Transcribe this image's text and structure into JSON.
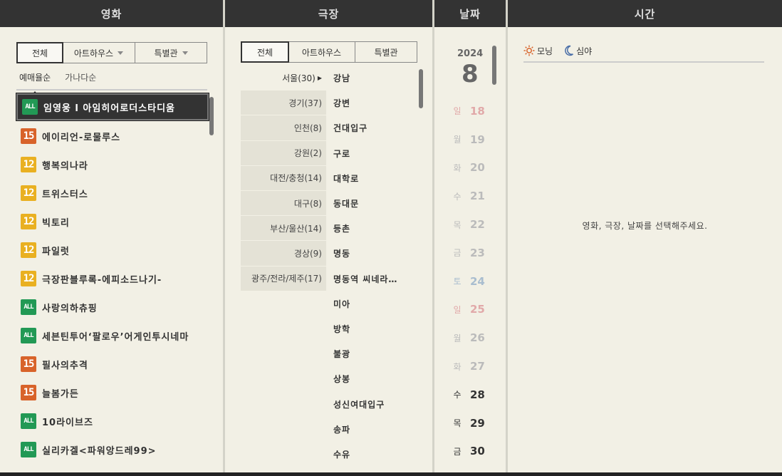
{
  "columns": {
    "movie": "영화",
    "theater": "극장",
    "date": "날짜",
    "time": "시간"
  },
  "movie_tabs": [
    {
      "label": "전체",
      "active": true,
      "dropdown": false
    },
    {
      "label": "아트하우스",
      "active": false,
      "dropdown": true
    },
    {
      "label": "특별관",
      "active": false,
      "dropdown": true
    }
  ],
  "sort": {
    "booking": "예매율순",
    "alpha": "가나다순"
  },
  "movies": [
    {
      "rating": "ALL",
      "title": "임영웅 l 아임히어로더스타디움",
      "selected": true
    },
    {
      "rating": "15",
      "title": "에이리언-로물루스"
    },
    {
      "rating": "12",
      "title": "행복의나라"
    },
    {
      "rating": "12",
      "title": "트위스터스"
    },
    {
      "rating": "12",
      "title": "빅토리"
    },
    {
      "rating": "12",
      "title": "파일럿"
    },
    {
      "rating": "12",
      "title": "극장판블루록-에피소드나기-"
    },
    {
      "rating": "ALL",
      "title": "사랑의하츄핑"
    },
    {
      "rating": "ALL",
      "title": "세븐틴투어‘팔로우’어게인투시네마"
    },
    {
      "rating": "15",
      "title": "필사의추격"
    },
    {
      "rating": "15",
      "title": "늘봄가든"
    },
    {
      "rating": "ALL",
      "title": "10라이브즈"
    },
    {
      "rating": "ALL",
      "title": "실리카겔<파워앙드레99>"
    }
  ],
  "theater_tabs": [
    {
      "label": "전체",
      "active": true
    },
    {
      "label": "아트하우스",
      "active": false
    },
    {
      "label": "특별관",
      "active": false
    }
  ],
  "regions": [
    "서울(30)",
    "경기(37)",
    "인천(8)",
    "강원(2)",
    "대전/충청(14)",
    "대구(8)",
    "부산/울산(14)",
    "경상(9)",
    "광주/전라/제주(17)"
  ],
  "theaters": [
    "강남",
    "강변",
    "건대입구",
    "구로",
    "대학로",
    "동대문",
    "등촌",
    "명동",
    "명동역 씨네라…",
    "미아",
    "방학",
    "불광",
    "상봉",
    "성신여대입구",
    "송파",
    "수유"
  ],
  "date": {
    "year": "2024",
    "month": "8",
    "days": [
      {
        "w": "일",
        "n": "18",
        "state": "sun"
      },
      {
        "w": "월",
        "n": "19",
        "state": "grey"
      },
      {
        "w": "화",
        "n": "20",
        "state": "grey"
      },
      {
        "w": "수",
        "n": "21",
        "state": "grey"
      },
      {
        "w": "목",
        "n": "22",
        "state": "grey"
      },
      {
        "w": "금",
        "n": "23",
        "state": "grey"
      },
      {
        "w": "토",
        "n": "24",
        "state": "sat"
      },
      {
        "w": "일",
        "n": "25",
        "state": "sun"
      },
      {
        "w": "월",
        "n": "26",
        "state": "grey"
      },
      {
        "w": "화",
        "n": "27",
        "state": "grey"
      },
      {
        "w": "수",
        "n": "28",
        "state": "avail"
      },
      {
        "w": "목",
        "n": "29",
        "state": "avail"
      },
      {
        "w": "금",
        "n": "30",
        "state": "avail"
      }
    ]
  },
  "time": {
    "morning": "모닝",
    "night": "심야",
    "message": "영화, 극장, 날짜를 선택해주세요."
  },
  "colors": {
    "header_bg": "#333333",
    "panel_bg": "#f2f0e5",
    "rating_all": "#229955",
    "rating_15": "#d8632a",
    "rating_12": "#e9b021"
  }
}
